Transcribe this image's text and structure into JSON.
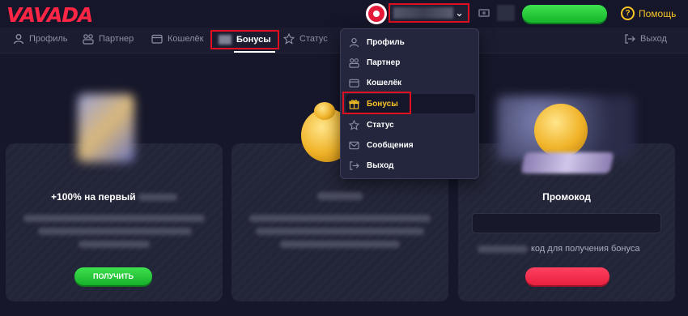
{
  "header": {
    "logo": "VAVADA",
    "help_label": "Помощь"
  },
  "nav": {
    "tabs": [
      {
        "label": "Профиль",
        "icon": "user-icon"
      },
      {
        "label": "Партнер",
        "icon": "partner-icon"
      },
      {
        "label": "Кошелёк",
        "icon": "wallet-icon"
      },
      {
        "label": "Бонусы",
        "icon": "gift-icon"
      },
      {
        "label": "Статус",
        "icon": "star-icon"
      }
    ],
    "logout_label": "Выход"
  },
  "dropdown": {
    "items": [
      {
        "label": "Профиль",
        "icon": "user-icon"
      },
      {
        "label": "Партнер",
        "icon": "partner-icon"
      },
      {
        "label": "Кошелёк",
        "icon": "wallet-icon"
      },
      {
        "label": "Бонусы",
        "icon": "gift-icon"
      },
      {
        "label": "Статус",
        "icon": "star-icon"
      },
      {
        "label": "Сообщения",
        "icon": "mail-icon"
      },
      {
        "label": "Выход",
        "icon": "logout-icon"
      }
    ]
  },
  "cards": {
    "first_deposit": {
      "title": "+100% на первый",
      "button_label": "ПОЛУЧИТЬ"
    },
    "promo": {
      "title": "Промокод",
      "hint": "код для получения бонуса"
    }
  },
  "colors": {
    "accent_red": "#ff2545",
    "accent_green": "#22c23a",
    "accent_yellow": "#f7c325",
    "background": "#17182a"
  }
}
